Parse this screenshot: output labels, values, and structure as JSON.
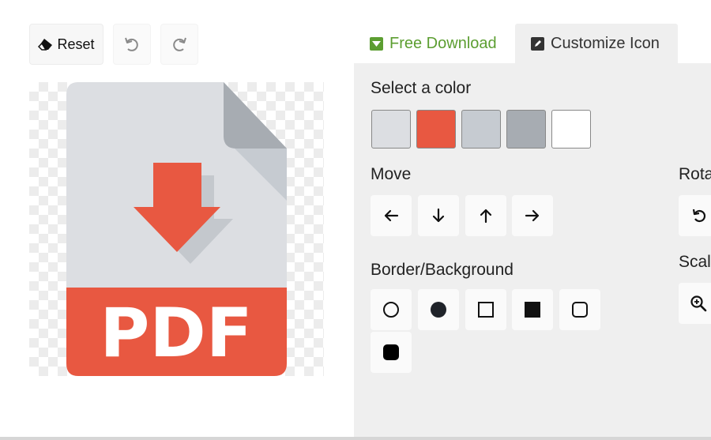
{
  "toolbar": {
    "reset_label": "Reset",
    "undo_icon": "undo-icon",
    "redo_icon": "redo-icon"
  },
  "preview": {
    "icon": "pdf-download-icon",
    "file_label": "PDF",
    "colors": {
      "page": "#dcdee2",
      "fold": "#a7acb2",
      "fold_light": "#c6cbd1",
      "accent": "#e85841",
      "shadow": "#c4c8cd"
    }
  },
  "tabs": [
    {
      "label": "Free Download",
      "icon": "download-icon",
      "color": "#5c9e31"
    },
    {
      "label": "Customize Icon",
      "icon": "edit-icon",
      "color": "#333333"
    }
  ],
  "panel": {
    "color_title": "Select a color",
    "swatches": [
      "#dcdee2",
      "#e85841",
      "#c6cbd1",
      "#a7acb2",
      "#ffffff"
    ],
    "move_title": "Move",
    "move_buttons": [
      "arrow-left-icon",
      "arrow-down-icon",
      "arrow-up-icon",
      "arrow-right-icon"
    ],
    "rotate_title": "Rota",
    "rotate_buttons": [
      "rotate-left-icon"
    ],
    "border_title": "Border/Background",
    "border_buttons": [
      "circle-outline-icon",
      "circle-filled-icon",
      "square-outline-icon",
      "square-filled-icon",
      "rounded-square-outline-icon",
      "rounded-square-filled-icon"
    ],
    "scale_title": "Scal",
    "scale_buttons": [
      "zoom-in-icon"
    ]
  }
}
